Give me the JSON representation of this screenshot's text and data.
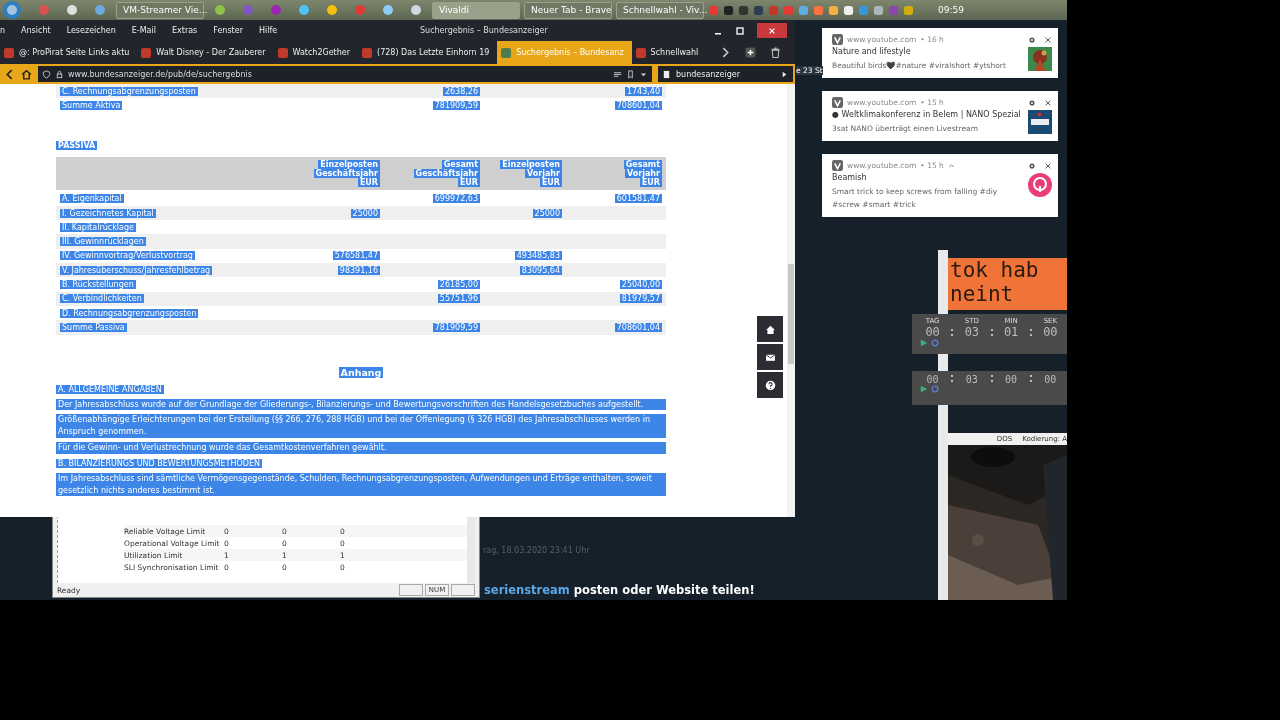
{
  "taskbar": {
    "buttons": [
      {
        "label": "VM-Streamer Vie...",
        "selected": false
      },
      {
        "label": "Vivaldi",
        "selected": true
      },
      {
        "label": "Neuer Tab - Brave",
        "selected": false
      },
      {
        "label": "Schnellwahl - Viv...",
        "selected": false
      }
    ],
    "clock": "09:59"
  },
  "browser": {
    "menu": [
      "n",
      "Ansicht",
      "Lesezeichen",
      "E-Mail",
      "Extras",
      "Fenster",
      "Hilfe"
    ],
    "title": "Suchergebnis – Bundesanzeiger",
    "tabs": [
      {
        "label": "@: ProPirat Seite Links aktu",
        "selected": false
      },
      {
        "label": "Walt Disney - Der Zauberer",
        "selected": false
      },
      {
        "label": "Watch2Gether",
        "selected": false
      },
      {
        "label": "(728) Das Letzte Einhorn 19",
        "selected": false
      },
      {
        "label": "Suchergebnis – Bundesanz",
        "selected": true
      },
      {
        "label": "Schnellwahl",
        "selected": false
      }
    ],
    "address": "www.bundesanzeiger.de/pub/de/suchergebnis",
    "search": "bundesanzeiger"
  },
  "page": {
    "selection_highlighted": true,
    "aktiva_rows": [
      {
        "label": "C. Rechnungsabgrenzungsposten",
        "total_year": "2638,26",
        "total_prev": "1743,40"
      },
      {
        "label": "Summe Aktiva",
        "total_year": "781909,59",
        "total_prev": "708601,04"
      }
    ],
    "passiva_heading": "PASSIVA",
    "columns": [
      [
        "Einzelposten",
        "Geschäftsjahr",
        "EUR"
      ],
      [
        "Gesamt",
        "Geschäftsjahr",
        "EUR"
      ],
      [
        "Einzelposten",
        "Vorjahr",
        "EUR"
      ],
      [
        "Gesamt",
        "Vorjahr",
        "EUR"
      ]
    ],
    "passiva_rows": [
      {
        "label": "A. Eigenkapital",
        "total_year": "699972,63",
        "total_prev": "601581,47"
      },
      {
        "label": "I. Gezeichnetes Kapital",
        "single_year": "25000",
        "single_prev": "25000"
      },
      {
        "label": "II. Kapitalrücklage"
      },
      {
        "label": "III. Gewinnrücklagen"
      },
      {
        "label": "IV. Gewinnvortrag/Verlustvortrag",
        "single_year": "576581,47",
        "single_prev": "493485,83"
      },
      {
        "label": "V. Jahresüberschuss/Jahresfehlbetrag",
        "single_year": "98391,16",
        "single_prev": "83095,64"
      },
      {
        "label": "B. Rückstellungen",
        "total_year": "26185,00",
        "total_prev": "25040,00"
      },
      {
        "label": "C. Verbindlichkeiten",
        "total_year": "55751,96",
        "total_prev": "81979,57"
      },
      {
        "label": "D. Rechnungsabgrenzungsposten"
      },
      {
        "label": "Summe Passiva",
        "total_year": "781909,59",
        "total_prev": "708601,04"
      }
    ],
    "appendix_title": "Anhang",
    "appendix": [
      {
        "kind": "heading",
        "text": "A. ALLGEMEINE ANGABEN"
      },
      {
        "kind": "text",
        "text": "Der Jahresabschluss wurde auf der Grundlage der Gliederungs-, Bilanzierungs- und Bewertungsvorschriften des Handelsgesetzbuches aufgestellt."
      },
      {
        "kind": "text",
        "text": "Größenabhängige Erleichterungen bei der Erstellung (§§ 266, 276, 288 HGB) und bei der Offenlegung (§ 326 HGB) des Jahresabschlusses werden in Anspruch genommen."
      },
      {
        "kind": "text",
        "text": "Für die Gewinn- und Verlustrechnung wurde das Gesamtkostenverfahren gewählt."
      },
      {
        "kind": "heading",
        "text": "B. BILANZIERUNGS UND BEWERTUNGSMETHODEN"
      },
      {
        "kind": "text",
        "text": "Im Jahresabschluss sind sämtliche Vermögensgegenstände, Schulden, Rechnungsabgrenzungsposten, Aufwendungen und Erträge enthalten, soweit gesetzlich nichts anderes bestimmt ist."
      }
    ]
  },
  "back_window": {
    "rows": [
      {
        "name": "Reliable Voltage Limit",
        "values": [
          "0",
          "0",
          "0"
        ]
      },
      {
        "name": "Operational Voltage Limit",
        "values": [
          "0",
          "0",
          "0"
        ]
      },
      {
        "name": "Utilization Limit",
        "values": [
          "1",
          "1",
          "1"
        ]
      },
      {
        "name": "SLI Synchronisation Limit",
        "values": [
          "0",
          "0",
          "0"
        ]
      }
    ],
    "status": "Ready",
    "indicator": "NUM"
  },
  "desktop": {
    "date_text": "rag, 18.03.2020 23:41 Uhr",
    "banner_link": "serienstream",
    "banner_text": "posten oder Website teilen!",
    "side_text": "e 23 St",
    "orange_lines": [
      "tok hab",
      "neint"
    ],
    "dos": "DOS",
    "encoding": "Kodierung: A"
  },
  "timers": [
    {
      "labels": [
        "TAG",
        "STD",
        "MIN",
        "SEK"
      ],
      "values": [
        "00",
        "03",
        "01",
        "00"
      ]
    },
    {
      "values": [
        "00",
        "03",
        "00",
        "00"
      ]
    }
  ],
  "notifications": [
    {
      "source": "www.youtube.com",
      "age": "• 16 h",
      "title": "Nature and lifestyle",
      "body": "Beautiful birds🖤#nature #viralshort #ytshort"
    },
    {
      "kind": "logo",
      "source": "www.youtube.com",
      "age": "• 15 h",
      "title": "● Weltklimakonferenz in Belem | NANO Spezial",
      "body": "3sat NANO überträgt einen Livestream"
    },
    {
      "kind": "round",
      "source": "www.youtube.com",
      "age": "• 15 h",
      "expanded": true,
      "title": "Beamish",
      "body": "Smart trick to keep screws from falling #diy #screw #smart #trick"
    }
  ]
}
